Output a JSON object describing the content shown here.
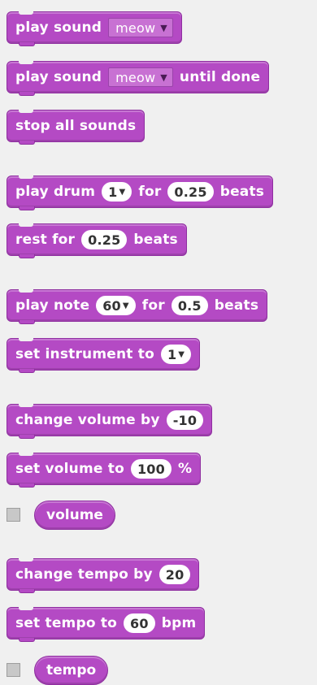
{
  "blocks": {
    "play_sound": {
      "label": "play sound",
      "sound": "meow"
    },
    "play_sound_until_done": {
      "label": "play sound",
      "sound": "meow",
      "suffix": "until done"
    },
    "stop_all_sounds": {
      "label": "stop all sounds"
    },
    "play_drum": {
      "label": "play drum",
      "drum": "1",
      "mid": "for",
      "beats": "0.25",
      "suffix": "beats"
    },
    "rest_for": {
      "label": "rest for",
      "beats": "0.25",
      "suffix": "beats"
    },
    "play_note": {
      "label": "play note",
      "note": "60",
      "mid": "for",
      "beats": "0.5",
      "suffix": "beats"
    },
    "set_instrument": {
      "label": "set instrument to",
      "instrument": "1"
    },
    "change_volume": {
      "label": "change volume by",
      "value": "-10"
    },
    "set_volume": {
      "label": "set volume to",
      "value": "100",
      "suffix": "%"
    },
    "volume_reporter": {
      "label": "volume"
    },
    "change_tempo": {
      "label": "change tempo by",
      "value": "20"
    },
    "set_tempo": {
      "label": "set tempo to",
      "value": "60",
      "suffix": "bpm"
    },
    "tempo_reporter": {
      "label": "tempo"
    }
  },
  "icons": {
    "dropdown_arrow": "▼"
  },
  "colors": {
    "block": "#b44ac4",
    "block_border": "#8f2fa0",
    "background": "#f0f0f0",
    "input_bg": "#ffffff"
  }
}
